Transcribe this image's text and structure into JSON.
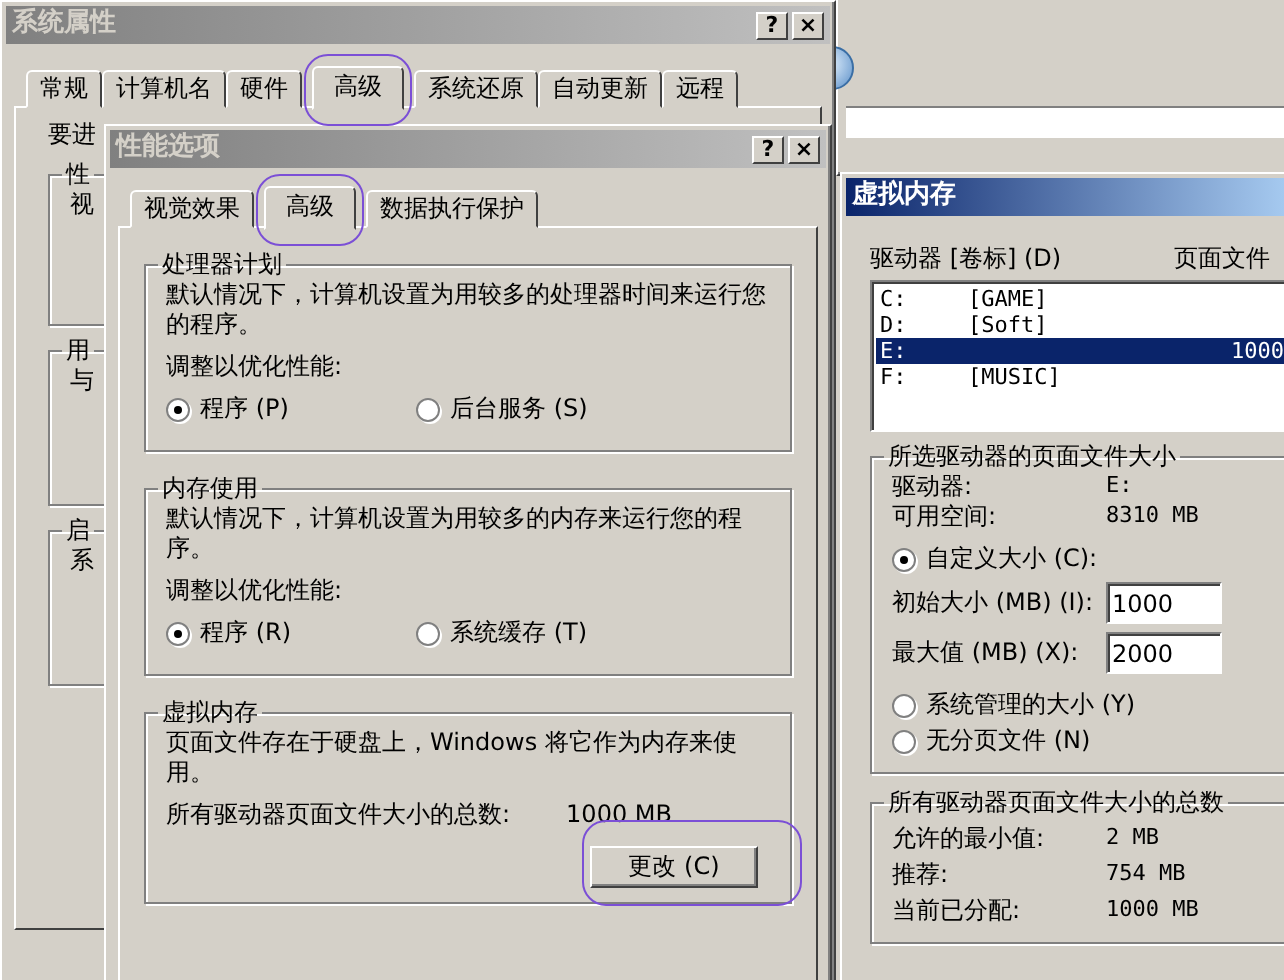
{
  "system_window": {
    "title": "系统属性",
    "help_button": "?",
    "close_button": "×",
    "tabs": [
      {
        "label": "常规",
        "selected": false,
        "highlighted": false
      },
      {
        "label": "计算机名",
        "selected": false,
        "highlighted": false
      },
      {
        "label": "硬件",
        "selected": false,
        "highlighted": false
      },
      {
        "label": "高级",
        "selected": true,
        "highlighted": true
      },
      {
        "label": "系统还原",
        "selected": false,
        "highlighted": false
      },
      {
        "label": "自动更新",
        "selected": false,
        "highlighted": false
      },
      {
        "label": "远程",
        "selected": false,
        "highlighted": false
      }
    ],
    "notice": "要进",
    "groups": [
      {
        "title": "性",
        "text": "视"
      },
      {
        "title": "用",
        "text": "与"
      },
      {
        "title": "启",
        "text": "系"
      }
    ]
  },
  "performance_window": {
    "title": "性能选项",
    "help_button": "?",
    "close_button": "×",
    "tabs": [
      {
        "label": "视觉效果",
        "selected": false,
        "highlighted": false
      },
      {
        "label": "高级",
        "selected": true,
        "highlighted": true
      },
      {
        "label": "数据执行保护",
        "selected": false,
        "highlighted": false
      }
    ],
    "groups": [
      {
        "kind": "options",
        "title": "处理器计划",
        "text": "默认情况下，计算机设置为用较多的处理器时间来运行您的程序。",
        "prompt": "调整以优化性能:",
        "options": [
          {
            "label": "程序 (P)",
            "selected": true
          },
          {
            "label": "后台服务 (S)",
            "selected": false
          }
        ]
      },
      {
        "kind": "options",
        "title": "内存使用",
        "text": "默认情况下，计算机设置为用较多的内存来运行您的程序。",
        "prompt": "调整以优化性能:",
        "options": [
          {
            "label": "程序 (R)",
            "selected": true
          },
          {
            "label": "系统缓存 (T)",
            "selected": false
          }
        ]
      },
      {
        "kind": "virtual",
        "title": "虚拟内存",
        "text": "页面文件存在于硬盘上，Windows 将它作为内存来使用。",
        "total_label": "所有驱动器页面文件大小的总数:",
        "total_value": "1000 MB",
        "button": {
          "label": "更改 (C)",
          "highlighted": true
        }
      }
    ]
  },
  "virtual_memory_window": {
    "title": "虚拟内存",
    "list_header": {
      "drive": "驱动器 [卷标] (D)",
      "size": "页面文件"
    },
    "drives": [
      {
        "drive": "C:",
        "label": "[GAME]",
        "selected": false
      },
      {
        "drive": "D:",
        "label": "[Soft]",
        "selected": false
      },
      {
        "drive": "E:",
        "size": "1000",
        "selected": true
      },
      {
        "drive": "F:",
        "label": "[MUSIC]",
        "selected": false
      }
    ],
    "selected_drive_group": {
      "title": "所选驱动器的页面文件大小",
      "info": [
        {
          "label": "驱动器:",
          "value": "E:"
        },
        {
          "label": "可用空间:",
          "value": "8310 MB"
        }
      ],
      "custom": {
        "label": "自定义大小 (C):",
        "selected": true
      },
      "fields": [
        {
          "label": "初始大小 (MB) (I):",
          "value": "1000"
        },
        {
          "label": "最大值 (MB) (X):",
          "value": "2000"
        }
      ],
      "other_options": [
        {
          "label": "系统管理的大小 (Y)",
          "selected": false
        },
        {
          "label": "无分页文件 (N)",
          "selected": false
        }
      ]
    },
    "totals_group": {
      "title": "所有驱动器页面文件大小的总数",
      "rows": [
        {
          "label": "允许的最小值:",
          "value": "2 MB"
        },
        {
          "label": "推荐:",
          "value": "754 MB"
        },
        {
          "label": "当前已分配:",
          "value": "1000 MB"
        }
      ]
    }
  }
}
